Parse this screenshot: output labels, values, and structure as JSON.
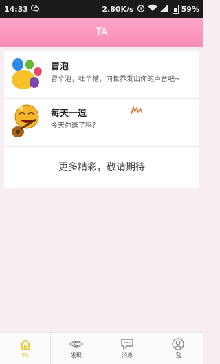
{
  "status_bar": {
    "time": "14:33",
    "network_speed": "2.80K/s",
    "battery": "59%",
    "icons": [
      "wechat-icon",
      "alarm-icon",
      "wifi-icon",
      "signal-icon",
      "battery-icon"
    ]
  },
  "header": {
    "title": "TA"
  },
  "cards": [
    {
      "title": "冒泡",
      "description": "冒个泡，吐个槽，向世界发出你的声音吧~",
      "icon": "maopao-logo-icon"
    },
    {
      "title": "每天一逗",
      "description": "今天你逗了吗？",
      "icon": "guitar-smiley-icon"
    }
  ],
  "more": {
    "label": "更多精彩，敬请期待"
  },
  "tabbar": {
    "tabs": [
      {
        "label": "TA",
        "icon": "home-icon",
        "active": true
      },
      {
        "label": "发现",
        "icon": "eye-icon",
        "active": false
      },
      {
        "label": "消息",
        "icon": "message-icon",
        "active": false
      },
      {
        "label": "我",
        "icon": "user-icon",
        "active": false
      }
    ]
  },
  "colors": {
    "header": "#f98cb8",
    "active_tab": "#e8c21c",
    "background": "#f6eef3"
  }
}
